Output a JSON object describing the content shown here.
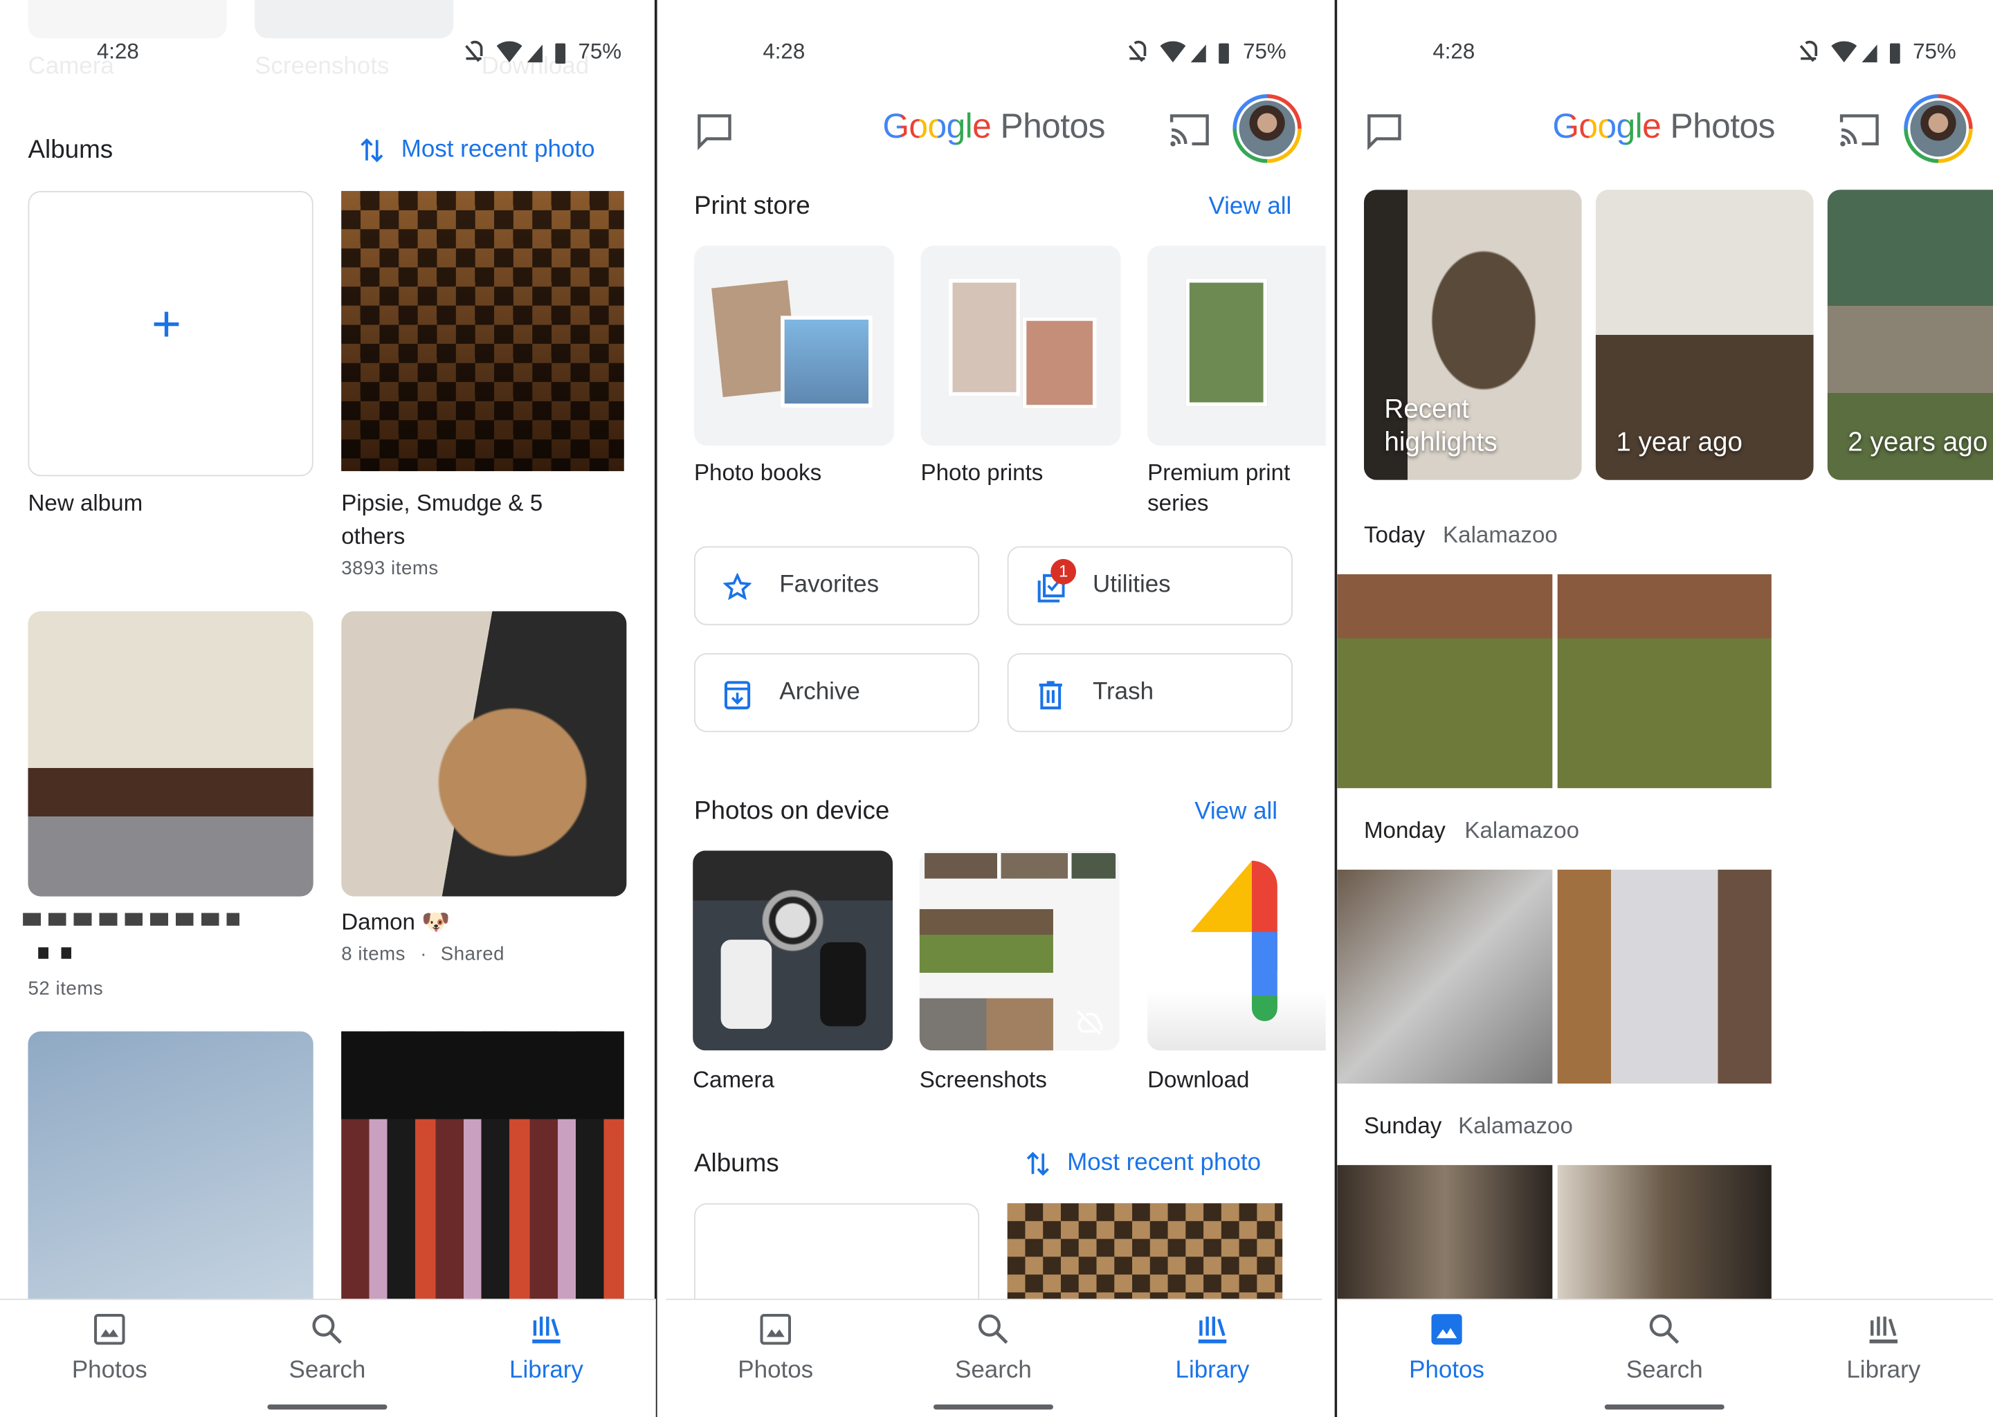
{
  "status": {
    "time": "4:28",
    "battery": "75%"
  },
  "colors": {
    "accent": "#1a73e8",
    "badge": "#d93025",
    "text": "#202124",
    "secondary": "#5f6368"
  },
  "panel1": {
    "faded_labels": [
      "Camera",
      "Screenshots",
      "Download"
    ],
    "albums_title": "Albums",
    "sort_label": "Most recent photo",
    "albums": [
      {
        "title": "New album"
      },
      {
        "title_line1": "Pipsie, Smudge & 5",
        "title_line2": "others",
        "count": "3893 items"
      },
      {
        "title": "",
        "count": "52 items"
      },
      {
        "title": "Damon 🐶",
        "count": "8 items",
        "shared": "Shared"
      }
    ]
  },
  "panel2": {
    "logo": {
      "google": "Google",
      "photos": "Photos"
    },
    "print_store": {
      "title": "Print store",
      "view_all": "View all",
      "items": [
        "Photo books",
        "Photo prints",
        "Premium print",
        "series"
      ]
    },
    "utilities": [
      {
        "label": "Favorites",
        "icon": "star-icon"
      },
      {
        "label": "Utilities",
        "icon": "utilities-icon",
        "badge": "1"
      },
      {
        "label": "Archive",
        "icon": "archive-icon"
      },
      {
        "label": "Trash",
        "icon": "trash-icon"
      }
    ],
    "device": {
      "title": "Photos on device",
      "view_all": "View all",
      "folders": [
        "Camera",
        "Screenshots",
        "Download"
      ]
    },
    "albums_title": "Albums",
    "sort_label": "Most recent photo"
  },
  "panel3": {
    "logo": {
      "google": "Google",
      "photos": "Photos"
    },
    "memories": [
      {
        "line1": "Recent",
        "line2": "highlights"
      },
      {
        "line1": "1 year ago"
      },
      {
        "line1": "2 years ago"
      }
    ],
    "days": [
      {
        "day": "Today",
        "place": "Kalamazoo"
      },
      {
        "day": "Monday",
        "place": "Kalamazoo"
      },
      {
        "day": "Sunday",
        "place": "Kalamazoo"
      }
    ]
  },
  "nav": {
    "photos": "Photos",
    "search": "Search",
    "library": "Library"
  },
  "nav_active": [
    "library",
    "library",
    "photos"
  ]
}
